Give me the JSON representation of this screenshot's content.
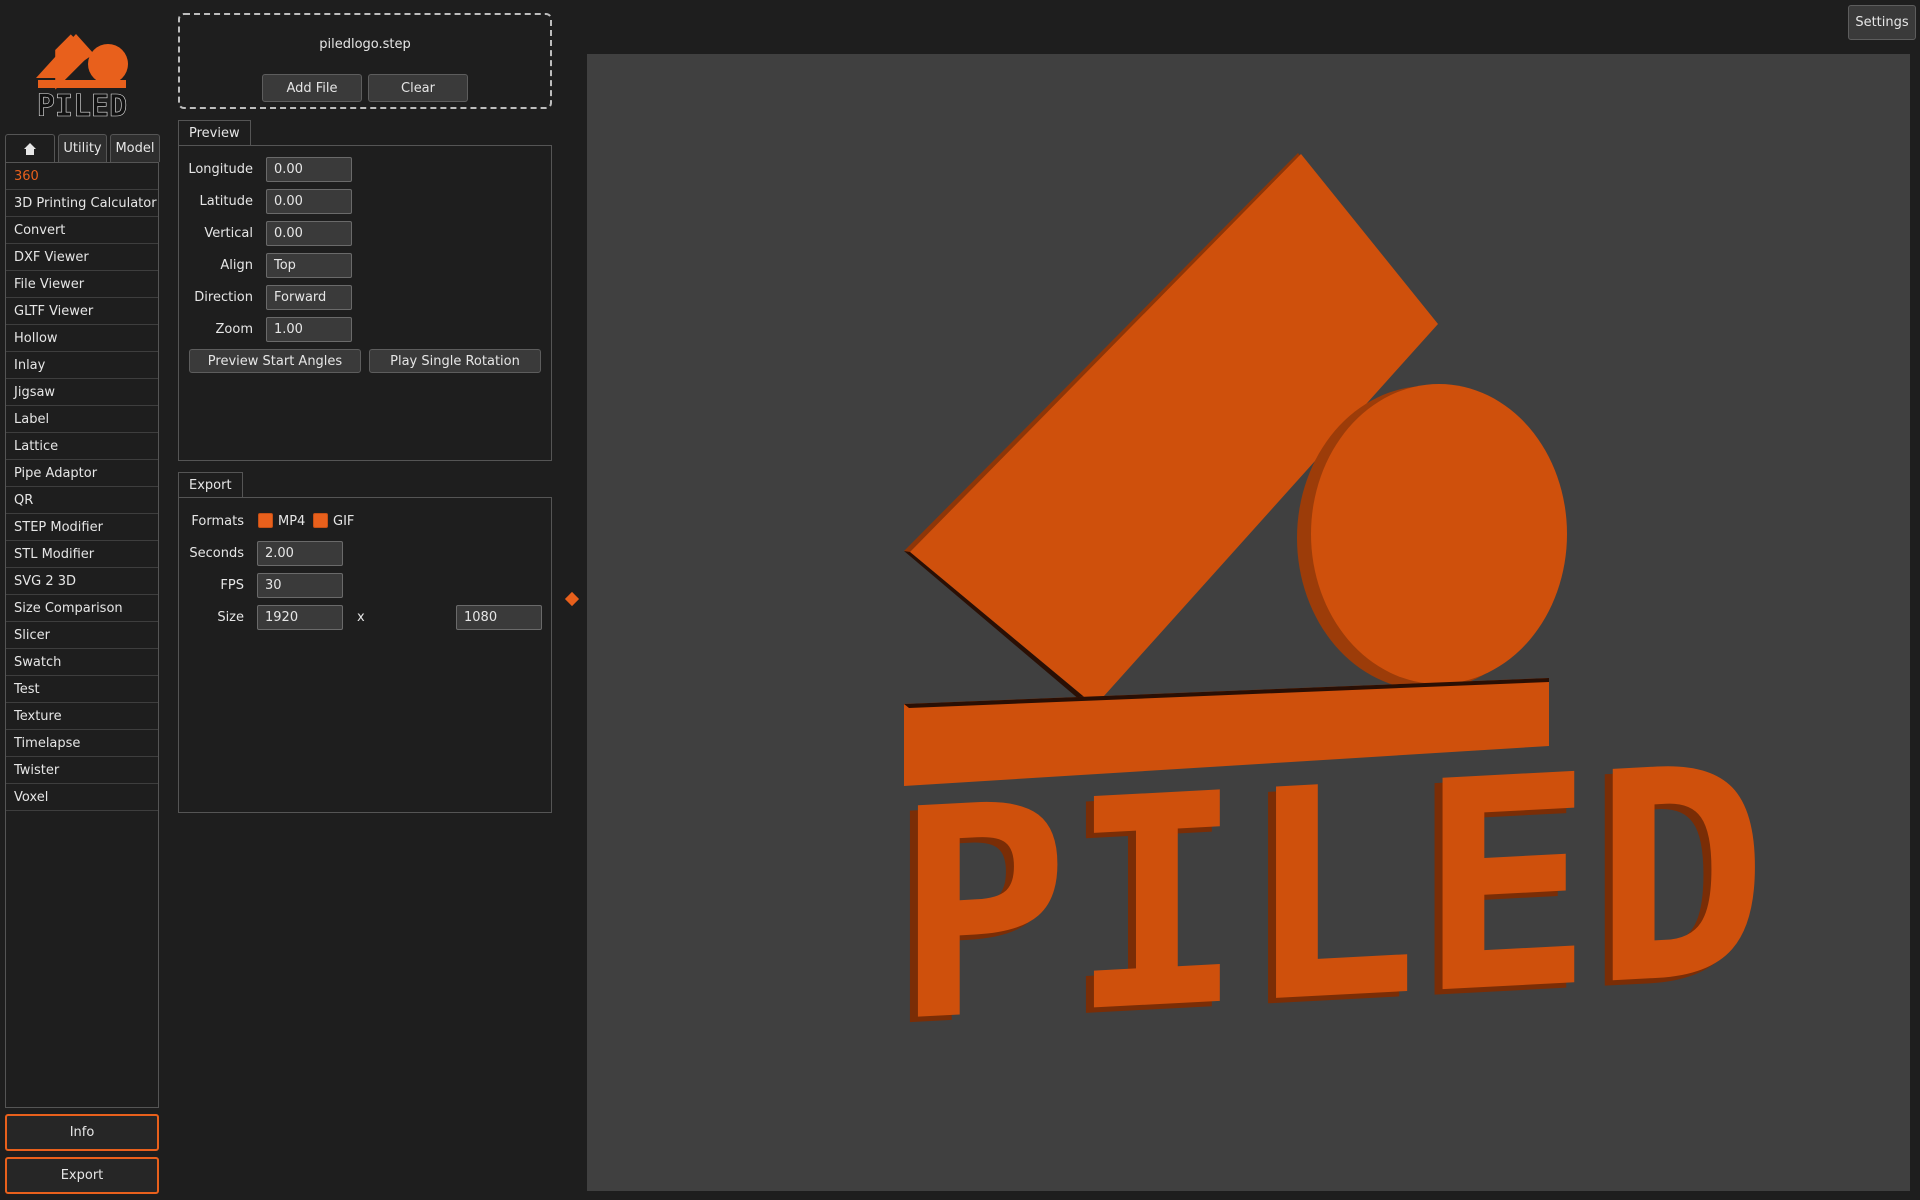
{
  "app": {
    "logo_text": "PILED",
    "accent_color": "#e8601c"
  },
  "tabs": [
    {
      "label": "",
      "icon": "home-icon"
    },
    {
      "label": "Utility"
    },
    {
      "label": "Model"
    }
  ],
  "tools": [
    "360",
    "3D Printing Calculator",
    "Convert",
    "DXF Viewer",
    "File Viewer",
    "GLTF Viewer",
    "Hollow",
    "Inlay",
    "Jigsaw",
    "Label",
    "Lattice",
    "Pipe Adaptor",
    "QR",
    "STEP Modifier",
    "STL Modifier",
    "SVG 2 3D",
    "Size Comparison",
    "Slicer",
    "Swatch",
    "Test",
    "Texture",
    "Timelapse",
    "Twister",
    "Voxel"
  ],
  "selected_tool": "360",
  "bottom_buttons": {
    "info": "Info",
    "export": "Export"
  },
  "file": {
    "name": "piledlogo.step",
    "add_label": "Add File",
    "clear_label": "Clear"
  },
  "preview": {
    "title": "Preview",
    "longitude_label": "Longitude",
    "longitude": "0.00",
    "latitude_label": "Latitude",
    "latitude": "0.00",
    "vertical_label": "Vertical",
    "vertical": "0.00",
    "align_label": "Align",
    "align": "Top",
    "direction_label": "Direction",
    "direction": "Forward",
    "zoom_label": "Zoom",
    "zoom": "1.00",
    "start_angles_label": "Preview Start Angles",
    "single_rotation_label": "Play Single Rotation"
  },
  "export": {
    "title": "Export",
    "formats_label": "Formats",
    "mp4_label": "MP4",
    "mp4_checked": true,
    "gif_label": "GIF",
    "gif_checked": true,
    "seconds_label": "Seconds",
    "seconds": "2.00",
    "fps_label": "FPS",
    "fps": "30",
    "size_label": "Size",
    "width": "1920",
    "x_label": "x",
    "height": "1080"
  },
  "viewport": {
    "model_text": "PILED",
    "background": "#404040",
    "model_color": "#cf500c"
  },
  "settings_label": "Settings"
}
